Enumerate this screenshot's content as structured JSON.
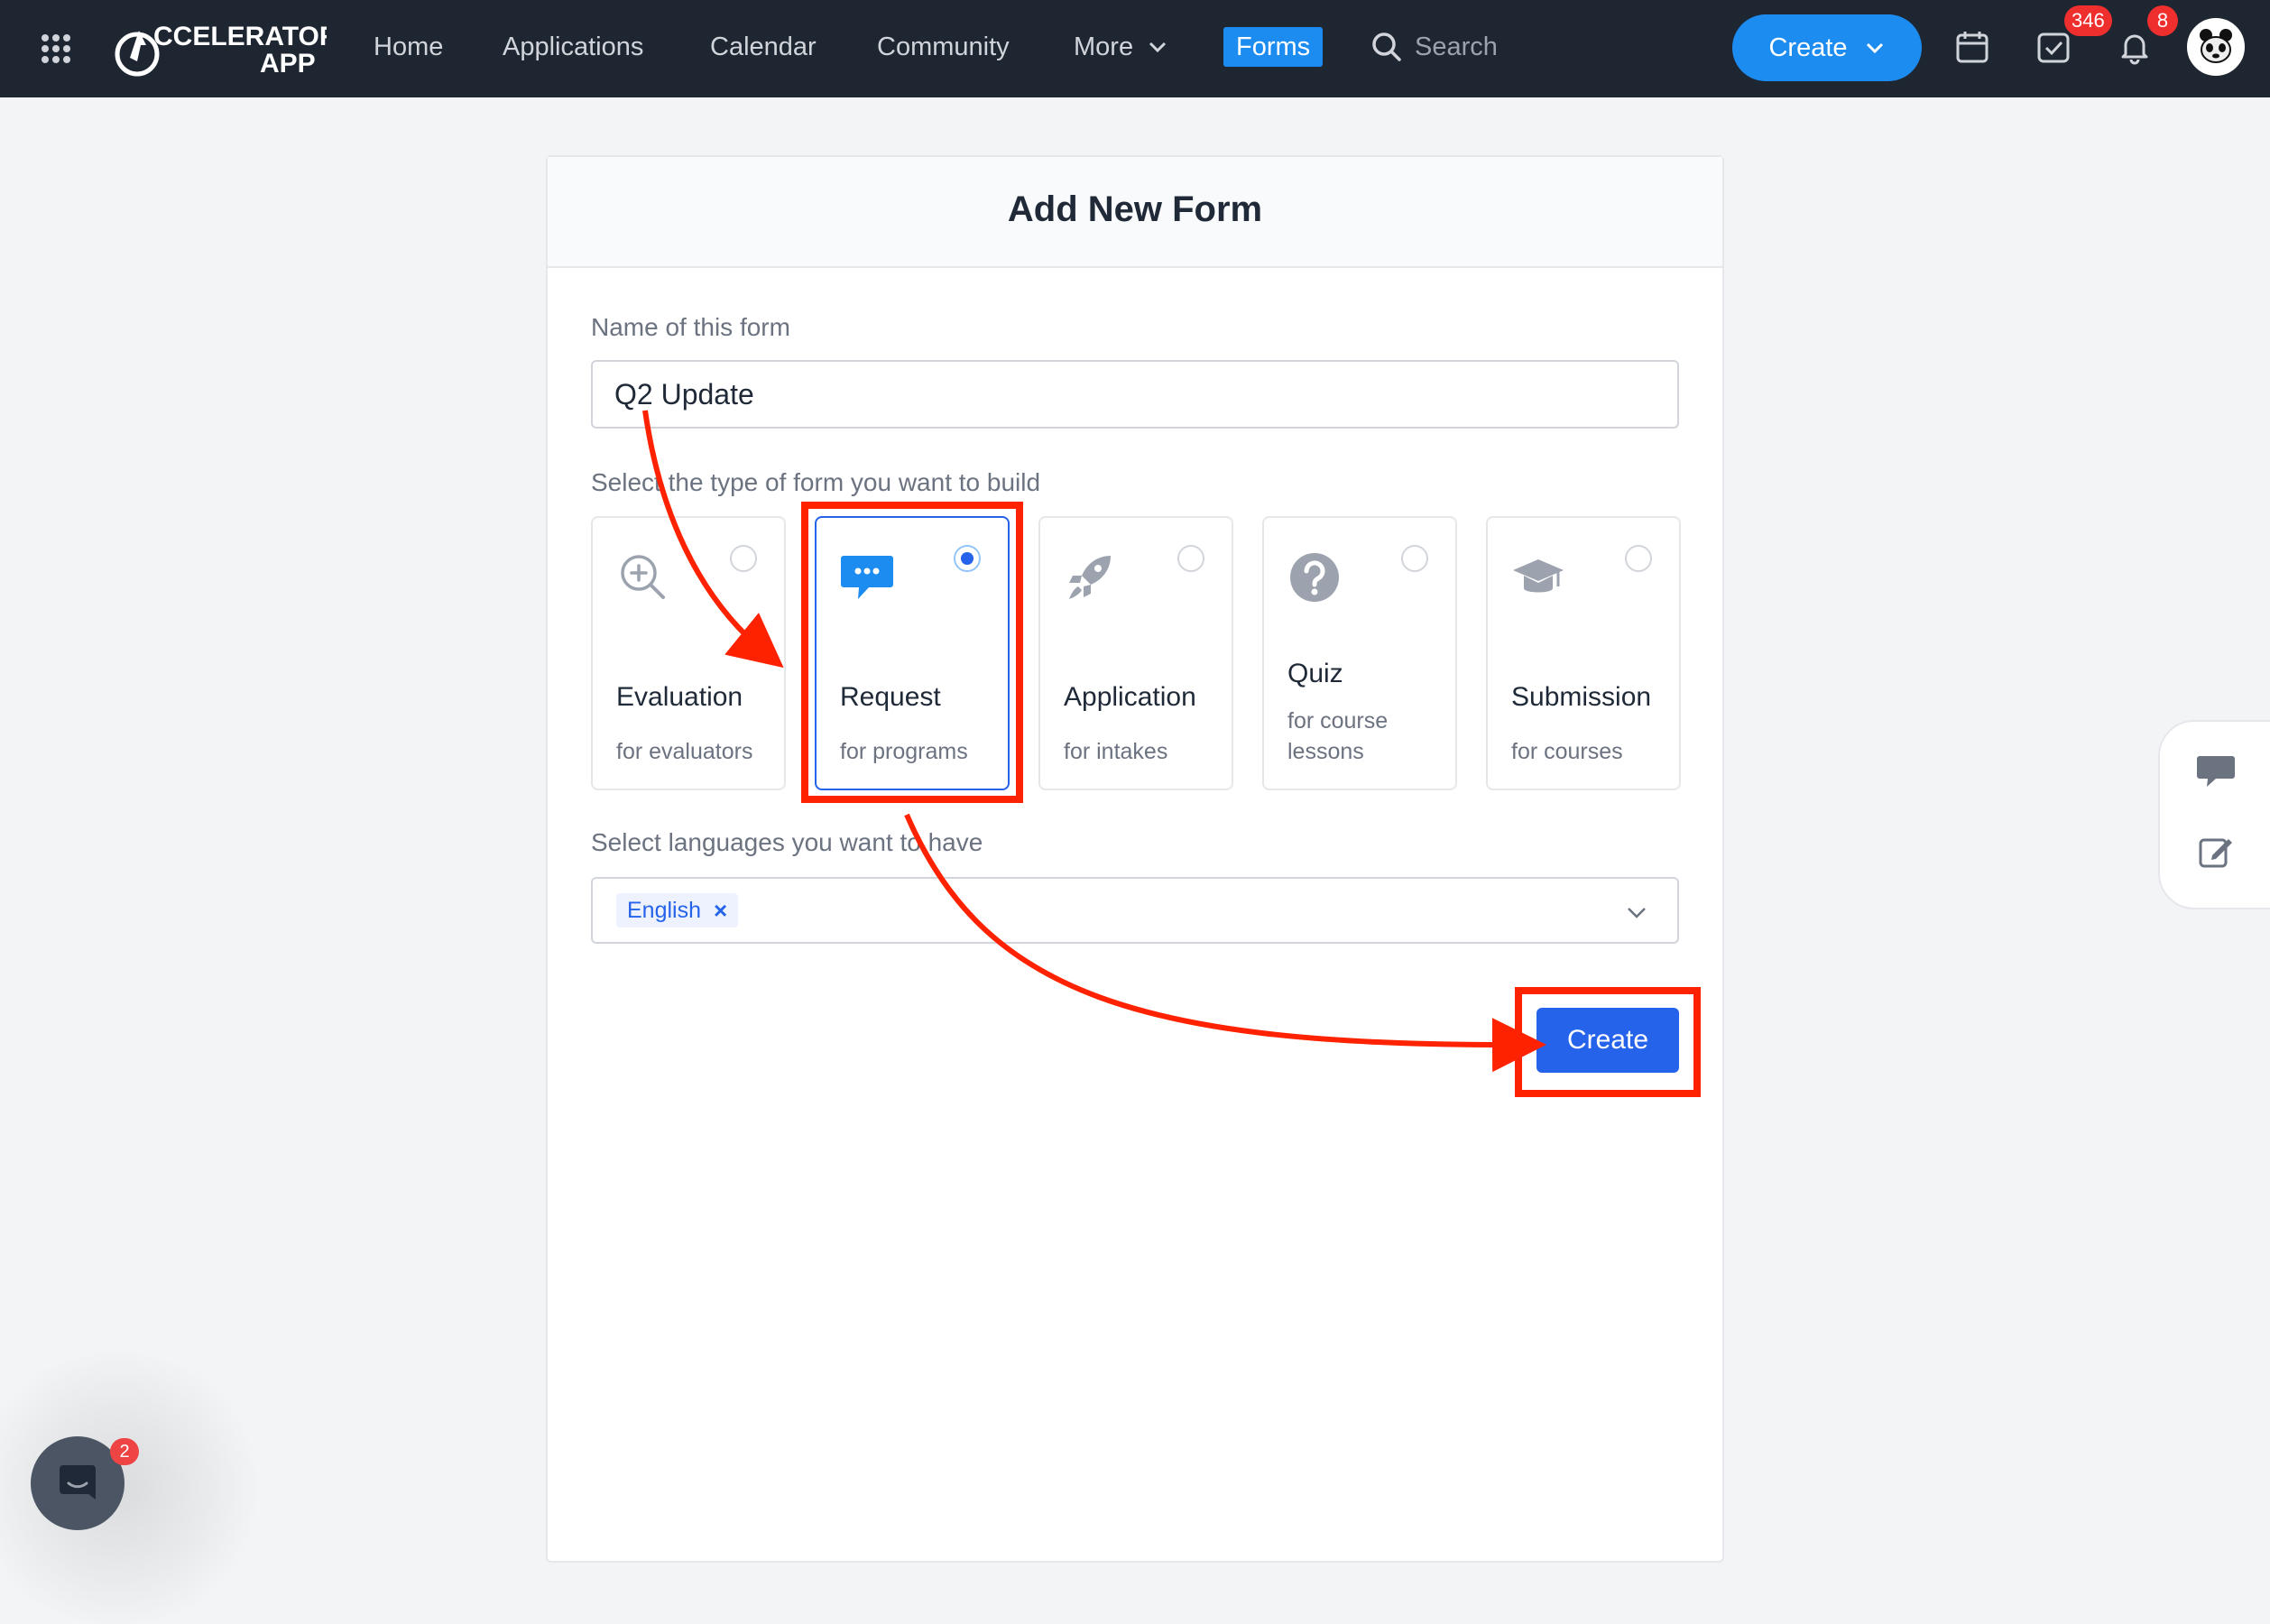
{
  "navbar": {
    "brand": "ACCELERATOR APP",
    "links": {
      "home": "Home",
      "applications": "Applications",
      "calendar": "Calendar",
      "community": "Community",
      "more": "More",
      "forms": "Forms"
    },
    "search_placeholder": "Search",
    "create_label": "Create",
    "tasks_badge": "346",
    "notifications_badge": "8"
  },
  "form": {
    "title": "Add New Form",
    "name_label": "Name of this form",
    "name_value": "Q2 Update",
    "type_label": "Select the type of form you want to build",
    "types": [
      {
        "name": "Evaluation",
        "sub": "for evaluators",
        "icon": "magnify-plus-icon",
        "selected": false
      },
      {
        "name": "Request",
        "sub": "for programs",
        "icon": "chat-bubble-icon",
        "selected": true
      },
      {
        "name": "Application",
        "sub": "for intakes",
        "icon": "rocket-icon",
        "selected": false
      },
      {
        "name": "Quiz",
        "sub": "for course lessons",
        "icon": "question-circle-icon",
        "selected": false
      },
      {
        "name": "Submission",
        "sub": "for courses",
        "icon": "graduation-cap-icon",
        "selected": false
      }
    ],
    "languages_label": "Select languages you want to have",
    "selected_language": "English",
    "create_label": "Create"
  },
  "chat": {
    "badge": "2"
  },
  "colors": {
    "navbar_bg": "#1e2631",
    "primary": "#2563eb",
    "nav_accent": "#1d8cf0",
    "annotation_red": "#ff2200",
    "badge_red": "#ef2e2e"
  }
}
